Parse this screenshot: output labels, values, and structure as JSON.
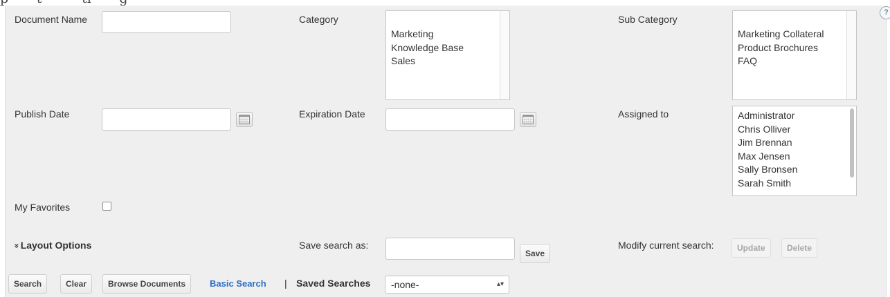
{
  "partial_heading": "p  • • t  • • • ti  • • g  • •",
  "help_glyph": "?",
  "fields": {
    "document_name_label": "Document Name",
    "category_label": "Category",
    "category_options": [
      "Marketing",
      "Knowledge Base",
      "Sales"
    ],
    "sub_category_label": "Sub Category",
    "sub_category_options": [
      "Marketing Collateral",
      "Product Brochures",
      "FAQ"
    ],
    "publish_date_label": "Publish Date",
    "expiration_date_label": "Expiration Date",
    "assigned_to_label": "Assigned to",
    "assigned_to_options": [
      "Administrator",
      "Chris Olliver",
      "Jim Brennan",
      "Max Jensen",
      "Sally Bronsen",
      "Sarah Smith"
    ],
    "my_favorites_label": "My Favorites",
    "my_favorites_checked": false
  },
  "layout_options": {
    "chevron": "»",
    "label": "Layout Options"
  },
  "save_search": {
    "label": "Save search as:",
    "button": "Save"
  },
  "modify_search": {
    "label": "Modify current search:",
    "update": "Update",
    "delete": "Delete"
  },
  "actions": {
    "search": "Search",
    "clear": "Clear",
    "browse": "Browse Documents",
    "basic_search": "Basic Search",
    "separator": "|",
    "saved_searches_label": "Saved Searches",
    "saved_searches_value": "-none-",
    "select_arrows": "▴▾"
  }
}
